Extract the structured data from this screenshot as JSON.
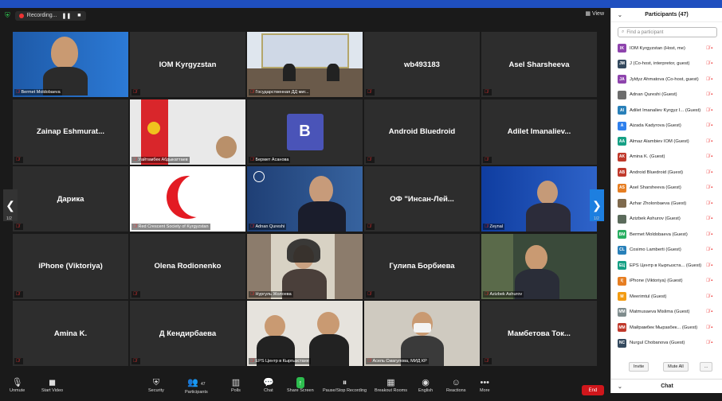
{
  "topbar": {
    "recording_label": "Recording...",
    "pause": "❚❚",
    "stop": "■",
    "view_label": "View"
  },
  "tiles": [
    {
      "name": "Bermet Moldobaeva",
      "show_center": false,
      "video": true,
      "kind": "photo-blue",
      "label": "Bermet Moldobaeva"
    },
    {
      "name": "IOM Kyrgyzstan",
      "show_center": true,
      "video": false,
      "label": ""
    },
    {
      "name": "Государственная ДД мигр...",
      "show_center": false,
      "video": true,
      "kind": "room",
      "label": "Государственная ДД миг..."
    },
    {
      "name": "wb493183",
      "show_center": true,
      "video": false,
      "label": ""
    },
    {
      "name": "Asel Sharsheeva",
      "show_center": true,
      "video": false,
      "label": ""
    },
    {
      "name": "Zainap Eshmurat...",
      "show_center": true,
      "video": false,
      "label": ""
    },
    {
      "name": "Уайтамбек Абдыкаттаев",
      "show_center": false,
      "video": true,
      "kind": "flag",
      "label": "Уайтамбек Абдыкаттаев"
    },
    {
      "name": "Бермет Асанова",
      "show_center": false,
      "video": true,
      "kind": "avatar-b",
      "label": "Бермет Асанова"
    },
    {
      "name": "Android Bluedroid",
      "show_center": true,
      "video": false,
      "label": ""
    },
    {
      "name": "Adilet Imanaliev...",
      "show_center": true,
      "video": false,
      "label": ""
    },
    {
      "name": "Дарика",
      "show_center": true,
      "video": false,
      "label": ""
    },
    {
      "name": "Red Crescent Society of Kyrgyzstan",
      "show_center": false,
      "video": true,
      "kind": "crescent",
      "label": "Red Crescent Society of Kyrgyzstan"
    },
    {
      "name": "Adnan Qureshi",
      "show_center": false,
      "video": true,
      "kind": "fao",
      "label": "Adnan Qureshi",
      "active": true
    },
    {
      "name": "ОФ \"Инсан-Лей...",
      "show_center": true,
      "video": false,
      "label": ""
    },
    {
      "name": "Zeynal",
      "show_center": false,
      "video": true,
      "kind": "iom-man",
      "label": "Zeynal"
    },
    {
      "name": "iPhone (Viktoriya)",
      "show_center": true,
      "video": false,
      "label": ""
    },
    {
      "name": "Olena Rodionenko",
      "show_center": true,
      "video": false,
      "label": ""
    },
    {
      "name": "Нургуль Жолоева",
      "show_center": false,
      "video": true,
      "kind": "woman",
      "label": "Нургуль Жолоева"
    },
    {
      "name": "Гулипа Борбиева",
      "show_center": true,
      "video": false,
      "label": ""
    },
    {
      "name": "Azizbek Ashurov",
      "show_center": false,
      "video": true,
      "kind": "man-suit",
      "label": "Azizbek Ashurov"
    },
    {
      "name": "Amina K.",
      "show_center": true,
      "video": false,
      "label": ""
    },
    {
      "name": "Д Кендирбаева",
      "show_center": true,
      "video": false,
      "label": ""
    },
    {
      "name": "EPS Центр в Кыргызстане",
      "show_center": false,
      "video": true,
      "kind": "two-men",
      "label": "EPS Центр в Кыргызстане"
    },
    {
      "name": "Асель Смагулова, МИД КР",
      "show_center": false,
      "video": true,
      "kind": "woman-mask",
      "label": "Асель Смагулова, МИД КР"
    },
    {
      "name": "Мамбетова Ток...",
      "show_center": true,
      "video": false,
      "label": ""
    }
  ],
  "pager": {
    "left": "1/2",
    "right": "1/2"
  },
  "toolbar": {
    "items": [
      {
        "id": "unmute",
        "label": "Unmute",
        "icon": "mic-off-icon"
      },
      {
        "id": "video",
        "label": "Start Video",
        "icon": "video-off-icon"
      },
      {
        "id": "security",
        "label": "Security",
        "icon": "shield-icon"
      },
      {
        "id": "participants",
        "label": "Participants",
        "count": "47",
        "icon": "people-icon"
      },
      {
        "id": "polls",
        "label": "Polls",
        "icon": "polls-icon"
      },
      {
        "id": "chat",
        "label": "Chat",
        "icon": "chat-icon"
      },
      {
        "id": "share",
        "label": "Share Screen",
        "icon": "share-icon"
      },
      {
        "id": "record",
        "label": "Pause/Stop Recording",
        "icon": "record-icon"
      },
      {
        "id": "breakout",
        "label": "Breakout Rooms",
        "icon": "breakout-icon"
      },
      {
        "id": "english",
        "label": "English",
        "icon": "globe-icon"
      },
      {
        "id": "reactions",
        "label": "Reactions",
        "icon": "smile-icon"
      },
      {
        "id": "more",
        "label": "More",
        "icon": "more-icon"
      }
    ],
    "end_label": "End"
  },
  "sidebar": {
    "title": "Participants (47)",
    "search_placeholder": "Find a participant",
    "participants": [
      {
        "initials": "IK",
        "color": "#8e44ad",
        "name": "IOM Kyrgyzstan (Host, me)"
      },
      {
        "initials": "JM",
        "color": "#34495e",
        "name": "J (Co-host, interpretor, guest)"
      },
      {
        "initials": "JA",
        "color": "#8e44ad",
        "name": "Jyldyz Ahmatova (Co-host, guest)"
      },
      {
        "initials": "",
        "color": "#6d6d6d",
        "name": "Adnan Qureshi (Guest)"
      },
      {
        "initials": "AI",
        "color": "#2980b9",
        "name": "Adilet Imanaliev Kyrgyz I... (Guest)"
      },
      {
        "initials": "A",
        "color": "#2f80ed",
        "name": "Aizada Kadyrova (Guest)"
      },
      {
        "initials": "AA",
        "color": "#16a085",
        "name": "Almaz Alambiev IOM (Guest)"
      },
      {
        "initials": "AK",
        "color": "#c0392b",
        "name": "Amina K. (Guest)"
      },
      {
        "initials": "AB",
        "color": "#c0392b",
        "name": "Android Bluedroid (Guest)"
      },
      {
        "initials": "AS",
        "color": "#e67e22",
        "name": "Asel Sharsheeva (Guest)"
      },
      {
        "initials": "",
        "color": "#7f6a4d",
        "name": "Azhar Zholonbaeva (Guest)"
      },
      {
        "initials": "",
        "color": "#5b6b5b",
        "name": "Azizbek Ashurov (Guest)"
      },
      {
        "initials": "BM",
        "color": "#27ae60",
        "name": "Bermet Moldobaeva (Guest)"
      },
      {
        "initials": "CL",
        "color": "#2980b9",
        "name": "Cosimo Lamberti (Guest)"
      },
      {
        "initials": "ЕЦ",
        "color": "#16a085",
        "name": "EPS Центр в Кыргызста... (Guest)"
      },
      {
        "initials": "I(",
        "color": "#e67e22",
        "name": "iPhone (Viktoriya) (Guest)"
      },
      {
        "initials": "M",
        "color": "#f39c12",
        "name": "Meerimtul (Guest)"
      },
      {
        "initials": "MM",
        "color": "#7f8c8d",
        "name": "Matmusaeva Mislima (Guest)"
      },
      {
        "initials": "MM",
        "color": "#c0392b",
        "name": "Майрамбек Мырзабек... (Guest)"
      },
      {
        "initials": "NC",
        "color": "#34495e",
        "name": "Nurgul Chobanova (Guest)"
      }
    ],
    "invite_label": "Invite",
    "mute_all_label": "Mute All",
    "more_label": "...",
    "chat_title": "Chat"
  }
}
